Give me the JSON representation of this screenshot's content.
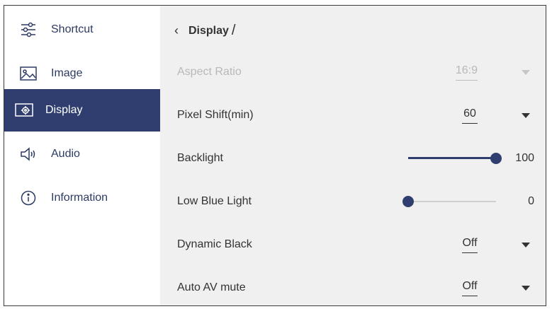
{
  "sidebar": {
    "items": [
      {
        "label": "Shortcut",
        "icon": "sliders-icon",
        "active": false
      },
      {
        "label": "Image",
        "icon": "picture-icon",
        "active": false
      },
      {
        "label": "Display",
        "icon": "display-gear-icon",
        "active": true
      },
      {
        "label": "Audio",
        "icon": "speaker-icon",
        "active": false
      },
      {
        "label": "Information",
        "icon": "info-icon",
        "active": false
      }
    ]
  },
  "breadcrumb": {
    "back_icon": "chevron-left-icon",
    "title": "Display",
    "separator": "/"
  },
  "settings": {
    "aspect_ratio": {
      "label": "Aspect Ratio",
      "value": "16:9",
      "disabled": true
    },
    "pixel_shift": {
      "label": "Pixel Shift(min)",
      "value": "60"
    },
    "backlight": {
      "label": "Backlight",
      "value": "100",
      "level": 100
    },
    "low_blue_light": {
      "label": "Low Blue Light",
      "value": "0",
      "level": 0
    },
    "dynamic_black": {
      "label": "Dynamic Black",
      "value": "Off"
    },
    "auto_av_mute": {
      "label": "Auto AV mute",
      "value": "Off"
    }
  },
  "colors": {
    "accent": "#2f3e6e",
    "panel": "#f0f0f0",
    "disabled": "#b8b8b8"
  }
}
